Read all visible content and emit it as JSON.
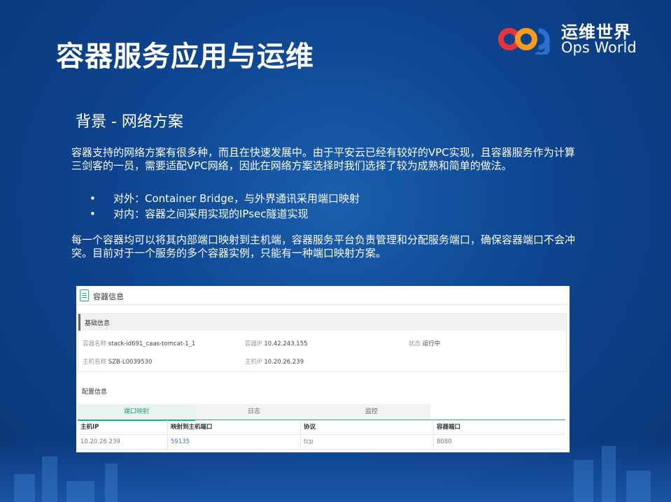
{
  "slide": {
    "title": "容器服务应用与运维",
    "subtitle": "背景 - 网络方案",
    "para1": "容器支持的网络方案有很多种，而且在快速发展中。由于平安云已经有较好的VPC实现，且容器服务作为计算三剑客的一员，需要适配VPC网络，因此在网络方案选择时我们选择了较为成熟和简单的做法。",
    "bullets": [
      {
        "marker": "•",
        "text": "对外：Container Bridge，与外界通讯采用端口映射"
      },
      {
        "marker": "•",
        "text": "对内：容器之间采用实现的IPsec隧道实现"
      }
    ],
    "para2": "每一个容器均可以将其内部端口映射到主机端，容器服务平台负责管理和分配服务端口，确保容器端口不会冲突。目前对于一个服务的多个容器实例，只能有一种端口映射方案。"
  },
  "logo": {
    "cn": "运维世界",
    "en": "Ops World",
    "mark_colors": [
      "#e8353b",
      "#f39c1f",
      "#2b6fd1"
    ]
  },
  "panel": {
    "header_title": "容器信息",
    "basic": {
      "section_title": "基础信息",
      "container_name_label": "容器名称",
      "container_name_value": "stack-id691_caas-tomcat-1_1",
      "container_ip_label": "容器IP",
      "container_ip_value": "10.42.243.155",
      "status_label": "状态",
      "status_value": "运行中",
      "host_name_label": "主机名称",
      "host_name_value": "SZB-L0039530",
      "host_ip_label": "主机IP",
      "host_ip_value": "10.20.26.239"
    },
    "config_title": "配置信息",
    "tabs": [
      "端口映射",
      "日志",
      "监控"
    ],
    "table": {
      "headers": [
        "主机IP",
        "映射到主机端口",
        "协议",
        "容器端口"
      ],
      "rows": [
        [
          "10.20.26.239",
          "59135",
          "tcp",
          "8080"
        ]
      ]
    }
  }
}
